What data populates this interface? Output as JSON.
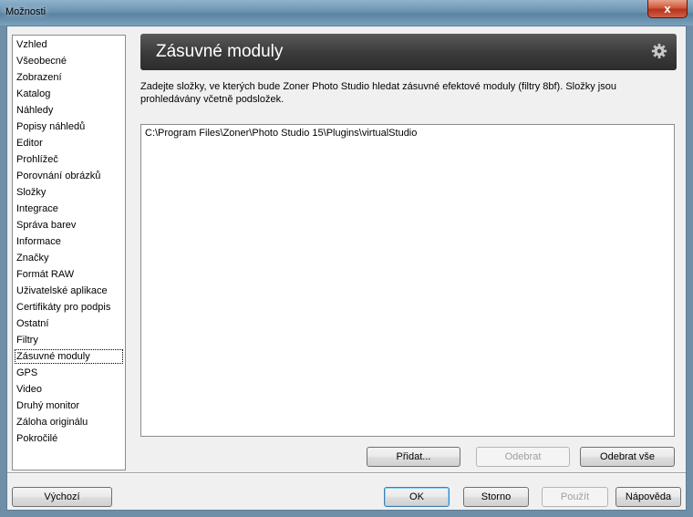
{
  "window": {
    "title": "Možnosti",
    "close_label": "x"
  },
  "nav": {
    "items": [
      {
        "label": "Vzhled"
      },
      {
        "label": "Všeobecné"
      },
      {
        "label": "Zobrazení"
      },
      {
        "label": "Katalog"
      },
      {
        "label": "Náhledy"
      },
      {
        "label": "Popisy náhledů"
      },
      {
        "label": "Editor"
      },
      {
        "label": "Prohlížeč"
      },
      {
        "label": "Porovnání obrázků"
      },
      {
        "label": "Složky"
      },
      {
        "label": "Integrace"
      },
      {
        "label": "Správa barev"
      },
      {
        "label": "Informace"
      },
      {
        "label": "Značky"
      },
      {
        "label": "Formát RAW"
      },
      {
        "label": "Uživatelské aplikace"
      },
      {
        "label": "Certifikáty pro podpis"
      },
      {
        "label": "Ostatní"
      },
      {
        "label": "Filtry"
      },
      {
        "label": "Zásuvné moduly",
        "selected": true
      },
      {
        "label": "GPS"
      },
      {
        "label": "Video"
      },
      {
        "label": "Druhý monitor"
      },
      {
        "label": "Záloha originálu"
      },
      {
        "label": "Pokročilé"
      }
    ]
  },
  "panel": {
    "title": "Zásuvné moduly",
    "settings_icon": "gear-icon",
    "description": "Zadejte složky, ve kterých bude Zoner Photo Studio hledat zásuvné efektové moduly (filtry 8bf). Složky jsou prohledávány včetně podsložek.",
    "folders": [
      "C:\\Program Files\\Zoner\\Photo Studio 15\\Plugins\\virtualStudio"
    ],
    "add_label": "Přidat...",
    "remove_label": "Odebrat",
    "remove_all_label": "Odebrat vše"
  },
  "footer": {
    "default_label": "Výchozí",
    "ok_label": "OK",
    "cancel_label": "Storno",
    "apply_label": "Použít",
    "help_label": "Nápověda"
  }
}
